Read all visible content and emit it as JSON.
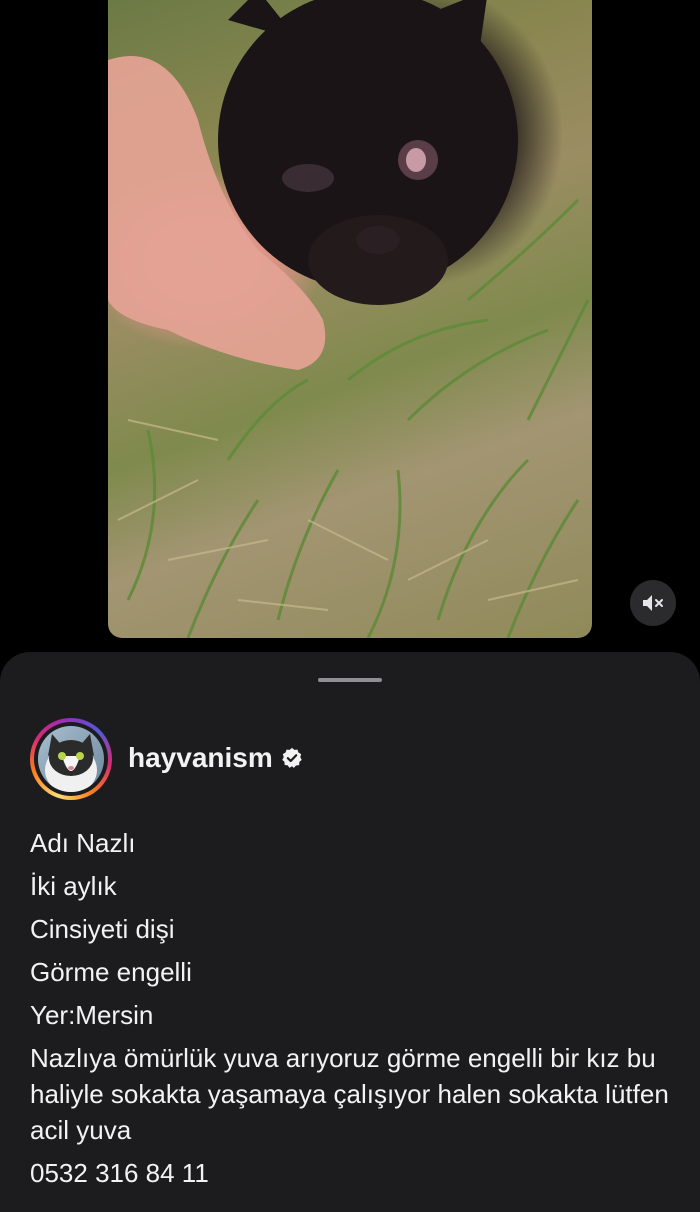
{
  "post": {
    "media_alt": "kitten-photo",
    "mute_icon": "speaker-muted-icon"
  },
  "author": {
    "username": "hayvanism",
    "verified_icon": "verified-badge-icon"
  },
  "caption": {
    "line1": "Adı Nazlı",
    "line2": "İki aylık",
    "line3": "Cinsiyeti dişi",
    "line4": "Görme engelli",
    "line5": "Yer:Mersin",
    "line6": "Nazlıya ömürlük yuva arıyoruz görme engelli bir kız bu haliyle sokakta yaşamaya çalışıyor halen sokakta lütfen acil yuva",
    "line7": "0532 316 84 11"
  },
  "colors": {
    "sheet_background": "#1c1c1e",
    "text": "#f2f2f2",
    "page_background": "#000000"
  }
}
